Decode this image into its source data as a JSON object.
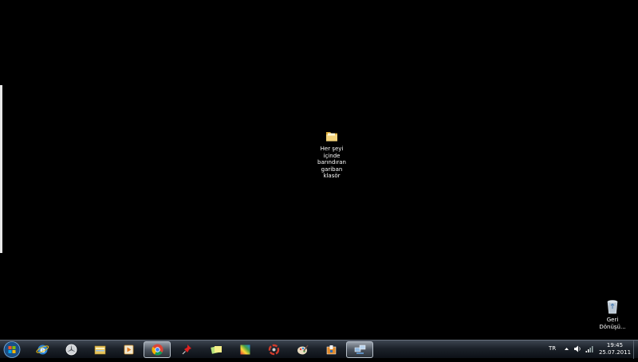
{
  "desktop": {
    "folder_label": "Her şeyi\niçinde\nbarındıran\ngariban\nklasör",
    "recycle_label": "Geri\nDönüşü..."
  },
  "taskbar": {
    "buttons": [
      {
        "name": "internet-explorer"
      },
      {
        "name": "mercedes-app"
      },
      {
        "name": "windows-explorer"
      },
      {
        "name": "media-player"
      },
      {
        "name": "google-chrome",
        "active": true
      },
      {
        "name": "pushpin-app"
      },
      {
        "name": "sticky-notes"
      },
      {
        "name": "color-app"
      },
      {
        "name": "circle-app"
      },
      {
        "name": "paint-app"
      },
      {
        "name": "box-app"
      },
      {
        "name": "network-app",
        "active": true
      }
    ]
  },
  "tray": {
    "language": "TR",
    "time": "19:45",
    "date": "25.07.2011"
  }
}
